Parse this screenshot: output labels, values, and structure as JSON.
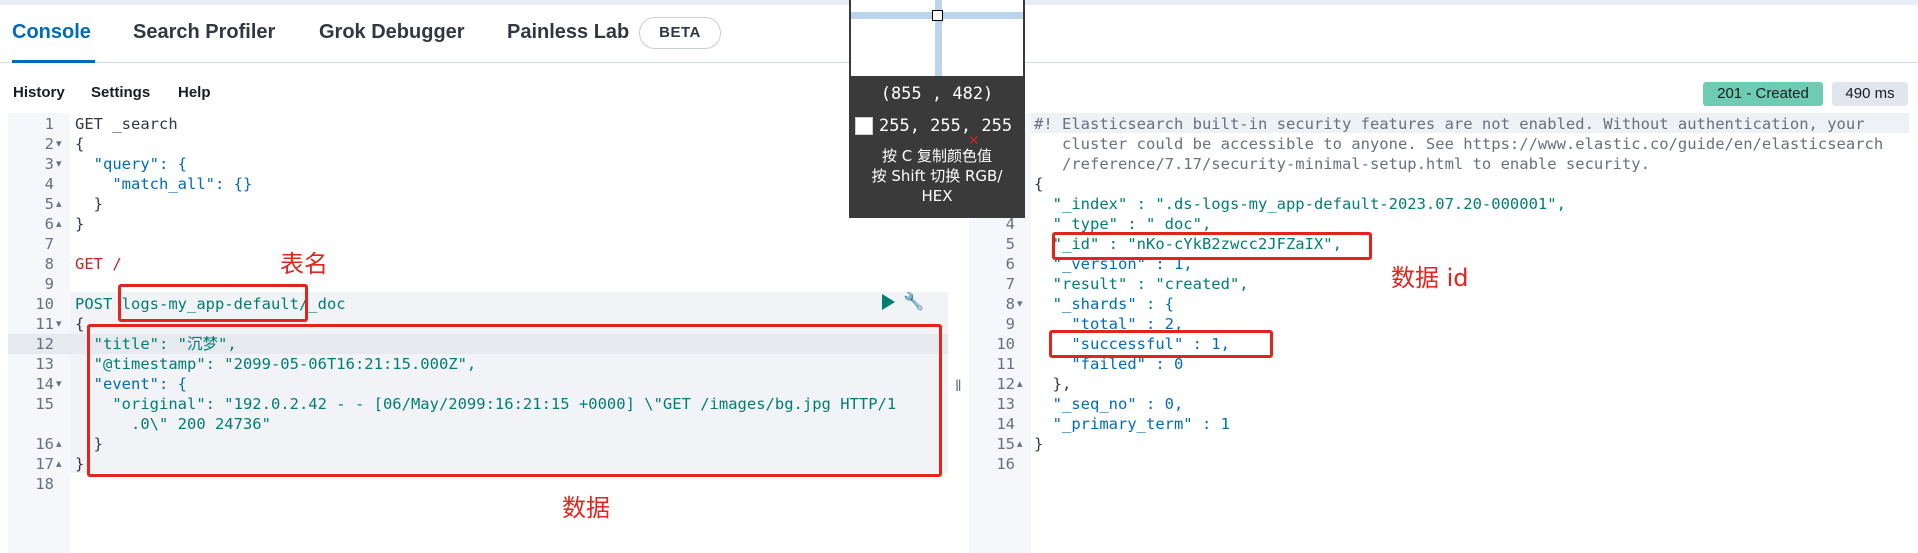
{
  "tabs": [
    {
      "label": "Console",
      "active": true
    },
    {
      "label": "Search Profiler"
    },
    {
      "label": "Grok Debugger"
    },
    {
      "label": "Painless Lab"
    }
  ],
  "beta_badge": "BETA",
  "menu": {
    "history": "History",
    "settings": "Settings",
    "help": "Help"
  },
  "response_status": {
    "code": "201 - Created",
    "time": "490 ms"
  },
  "left_editor": {
    "lines": [
      {
        "n": "1",
        "text": "GET _search"
      },
      {
        "n": "2",
        "text": "{"
      },
      {
        "n": "3",
        "text": "  \"query\": {"
      },
      {
        "n": "4",
        "text": "    \"match_all\": {}"
      },
      {
        "n": "5",
        "text": "  }"
      },
      {
        "n": "6",
        "text": "}"
      },
      {
        "n": "7",
        "text": ""
      },
      {
        "n": "8",
        "text": "GET /"
      },
      {
        "n": "9",
        "text": ""
      },
      {
        "n": "10",
        "text": "POST logs-my_app-default/_doc"
      },
      {
        "n": "11",
        "text": "{"
      },
      {
        "n": "12",
        "text": "  \"title\": \"沉梦\","
      },
      {
        "n": "13",
        "text": "  \"@timestamp\": \"2099-05-06T16:21:15.000Z\","
      },
      {
        "n": "14",
        "text": "  \"event\": {"
      },
      {
        "n": "15",
        "text": "    \"original\": \"192.0.2.42 - - [06/May/2099:16:21:15 +0000] \\\"GET /images/bg.jpg HTTP/1"
      },
      {
        "n": "",
        "text": "      .0\\\" 200 24736\""
      },
      {
        "n": "16",
        "text": "  }"
      },
      {
        "n": "17",
        "text": "}"
      },
      {
        "n": "18",
        "text": ""
      }
    ]
  },
  "right_editor": {
    "lines": [
      {
        "n": "1",
        "text": "#! Elasticsearch built-in security features are not enabled. Without authentication, your"
      },
      {
        "n": "",
        "text": "   cluster could be accessible to anyone. See https://www.elastic.co/guide/en/elasticsearch"
      },
      {
        "n": "",
        "text": "   /reference/7.17/security-minimal-setup.html to enable security."
      },
      {
        "n": "2",
        "text": "{"
      },
      {
        "n": "3",
        "text": "  \"_index\" : \".ds-logs-my_app-default-2023.07.20-000001\","
      },
      {
        "n": "4",
        "text": "  \"_type\" : \"_doc\","
      },
      {
        "n": "5",
        "text": "  \"_id\" : \"nKo-cYkB2zwcc2JFZaIX\","
      },
      {
        "n": "6",
        "text": "  \"_version\" : 1,"
      },
      {
        "n": "7",
        "text": "  \"result\" : \"created\","
      },
      {
        "n": "8",
        "text": "  \"_shards\" : {"
      },
      {
        "n": "9",
        "text": "    \"total\" : 2,"
      },
      {
        "n": "10",
        "text": "    \"successful\" : 1,"
      },
      {
        "n": "11",
        "text": "    \"failed\" : 0"
      },
      {
        "n": "12",
        "text": "  },"
      },
      {
        "n": "13",
        "text": "  \"_seq_no\" : 0,"
      },
      {
        "n": "14",
        "text": "  \"_primary_term\" : 1"
      },
      {
        "n": "15",
        "text": "}"
      },
      {
        "n": "16",
        "text": ""
      }
    ]
  },
  "annotations": {
    "table_name": "表名",
    "data": "数据",
    "data_id": "数据 id"
  },
  "color_picker": {
    "coords": "(855 , 482)",
    "rgb": "255, 255, 255",
    "hint_line1": "按 C 复制颜色值",
    "hint_line2": "按 Shift 切换 RGB/",
    "hint_line3": "HEX"
  },
  "colors": {
    "accent": "#006bb8",
    "annotation": "#e3241c",
    "success_badge": "#6dccb1"
  }
}
